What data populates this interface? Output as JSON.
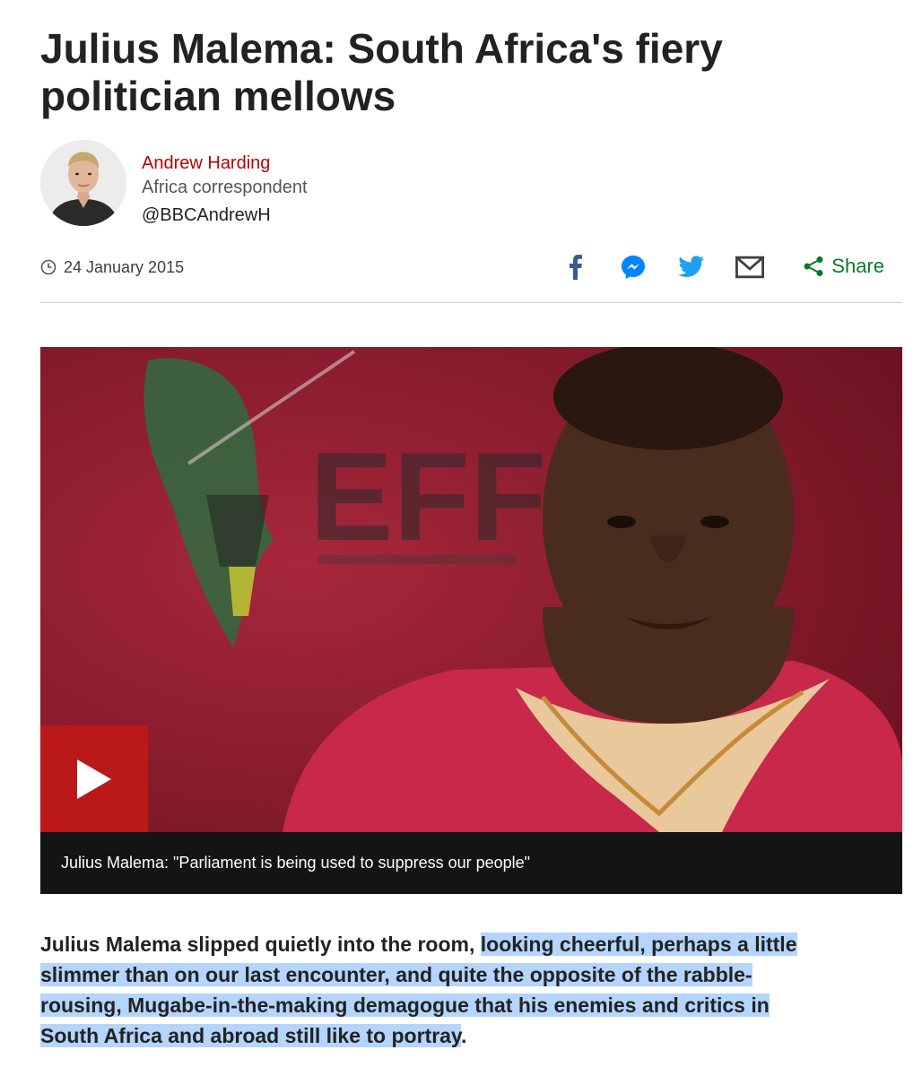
{
  "article": {
    "headline": "Julius Malema: South Africa's fiery politician mellows"
  },
  "byline": {
    "name": "Andrew Harding",
    "role": "Africa correspondent",
    "handle": "@BBCAndrewH"
  },
  "meta": {
    "date": "24 January 2015"
  },
  "share": {
    "label": "Share",
    "icons": [
      "facebook-icon",
      "messenger-icon",
      "twitter-icon",
      "email-icon",
      "share-icon"
    ]
  },
  "media": {
    "backdrop_text": "EFF",
    "caption": "Julius Malema: \"Parliament is being used to suppress our people\""
  },
  "body": {
    "intro_plain": "Julius Malema slipped quietly into the room, ",
    "intro_selected": "looking cheerful, perhaps a little slimmer than on our last encounter, and quite the opposite of the rabble-rousing, Mugabe-in-the-making demagogue that his enemies and critics in South Africa and abroad still like to portray",
    "intro_end": "."
  },
  "colors": {
    "accent_red": "#bb1919",
    "author_red": "#b80000",
    "share_green": "#0a7a2a",
    "selection_blue": "#b4d5fe",
    "caption_bg": "#141414"
  }
}
